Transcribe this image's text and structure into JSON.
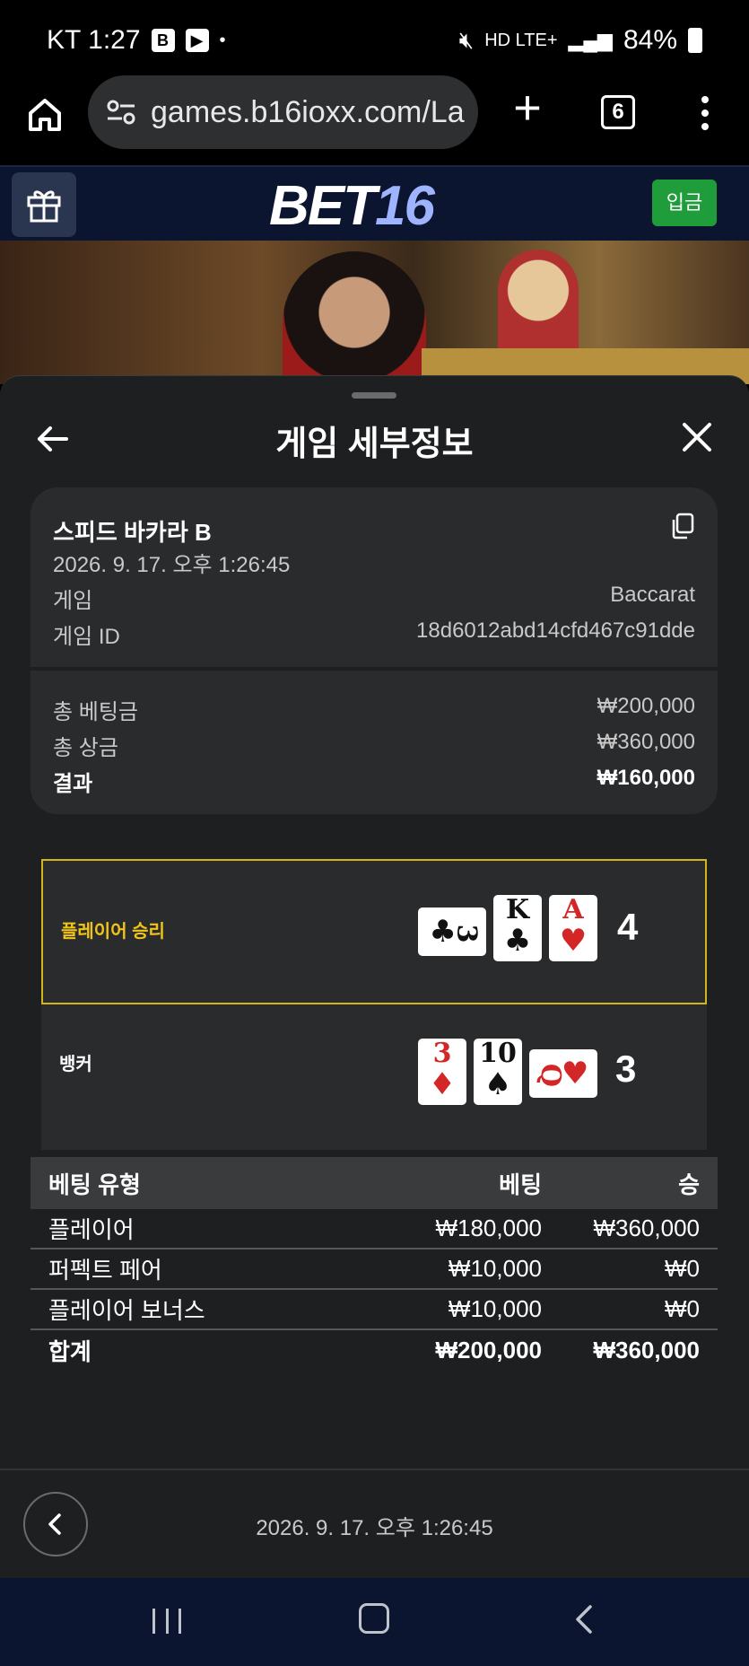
{
  "status_bar": {
    "carrier_time": "KT 1:27",
    "network": "HD LTE+",
    "battery": "84%"
  },
  "browser": {
    "url": "games.b16ioxx.com/La",
    "tab_count": "6"
  },
  "site": {
    "logo_text": "BET",
    "logo_number": "16",
    "deposit_label": "입금"
  },
  "sheet": {
    "title": "게임 세부정보"
  },
  "game": {
    "name": "스피드 바카라 B",
    "datetime": "2026. 9. 17. 오후 1:26:45",
    "game_label": "게임",
    "game_value": "Baccarat",
    "id_label": "게임 ID",
    "id_value": "18d6012abd14cfd467c91dde"
  },
  "summary": {
    "total_bet_label": "총 베팅금",
    "total_bet_value": "₩200,000",
    "total_win_label": "총 상금",
    "total_win_value": "₩360,000",
    "result_label": "결과",
    "result_value": "₩160,000"
  },
  "hands": {
    "player": {
      "label": "플레이어 승리",
      "score": "4",
      "cards": [
        {
          "rank": "3",
          "suit": "♣",
          "color": "#111111",
          "orientation": "horizontal"
        },
        {
          "rank": "K",
          "suit": "♣",
          "color": "#111111",
          "orientation": "vertical"
        },
        {
          "rank": "A",
          "suit": "♥",
          "color": "#d32626",
          "orientation": "vertical"
        }
      ]
    },
    "banker": {
      "label": "뱅커",
      "score": "3",
      "cards": [
        {
          "rank": "3",
          "suit": "♦",
          "color": "#d32626",
          "orientation": "vertical"
        },
        {
          "rank": "10",
          "suit": "♠",
          "color": "#111111",
          "orientation": "vertical"
        },
        {
          "rank": "Q",
          "suit": "♥",
          "color": "#d32626",
          "orientation": "horizontal"
        }
      ]
    }
  },
  "bet_table": {
    "headers": {
      "type": "베팅 유형",
      "bet": "베팅",
      "win": "승"
    },
    "rows": [
      {
        "type": "플레이어",
        "bet": "₩180,000",
        "win": "₩360,000"
      },
      {
        "type": "퍼펙트 페어",
        "bet": "₩10,000",
        "win": "₩0"
      },
      {
        "type": "플레이어 보너스",
        "bet": "₩10,000",
        "win": "₩0"
      }
    ],
    "total": {
      "type": "합계",
      "bet": "₩200,000",
      "win": "₩360,000"
    }
  },
  "footer": {
    "datetime": "2026. 9. 17. 오후 1:26:45"
  },
  "colors": {
    "player_win_accent": "#d4b516",
    "deposit_button": "#1f9d3a",
    "header_bg": "#0b1530",
    "sheet_bg": "#1e1f21"
  }
}
